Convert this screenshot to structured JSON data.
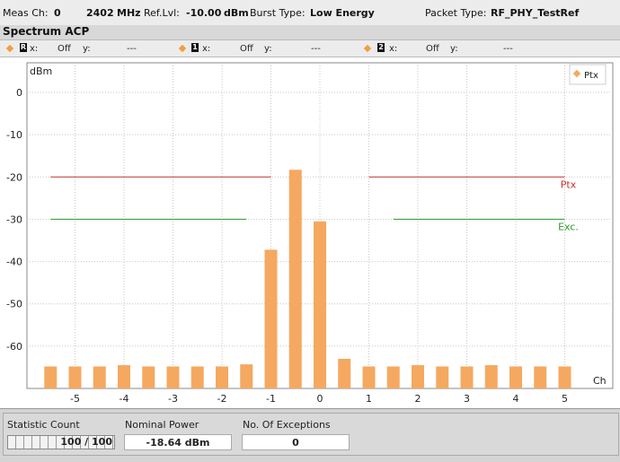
{
  "header": {
    "meas_ch_label": "Meas Ch:",
    "meas_ch_value": "0",
    "freq_value": "2402",
    "freq_unit": "MHz",
    "ref_lvl_label": "Ref.Lvl:",
    "ref_lvl_value": "-10.00",
    "ref_lvl_unit": "dBm",
    "burst_type_label": "Burst Type:",
    "burst_type_value": "Low Energy",
    "packet_type_label": "Packet Type:",
    "packet_type_value": "RF_PHY_TestRef"
  },
  "title": "Spectrum ACP",
  "markers": [
    {
      "id": "R",
      "x_label": "x:",
      "x_value": "Off",
      "y_label": "y:",
      "y_value": "---"
    },
    {
      "id": "1",
      "x_label": "x:",
      "x_value": "Off",
      "y_label": "y:",
      "y_value": "---"
    },
    {
      "id": "2",
      "x_label": "x:",
      "x_value": "Off",
      "y_label": "y:",
      "y_value": "---"
    }
  ],
  "chart_data": {
    "type": "bar",
    "ylabel": "dBm",
    "xlabel": "Ch",
    "ylim": [
      -70,
      0
    ],
    "y_ticks": [
      0,
      -10,
      -20,
      -30,
      -40,
      -50,
      -60
    ],
    "x_ticks": [
      -5,
      -4,
      -3,
      -2,
      -1,
      0,
      1,
      2,
      3,
      4,
      5
    ],
    "legend": {
      "name": "Ptx",
      "placement": "top-right"
    },
    "series": [
      {
        "name": "Ptx",
        "color": "#f5a860",
        "x": [
          -5.5,
          -5,
          -4.5,
          -4,
          -3.5,
          -3,
          -2.5,
          -2,
          -1.5,
          -1,
          -0.5,
          0,
          0.5,
          1,
          1.5,
          2,
          2.5,
          3,
          3.5,
          4,
          4.5,
          5
        ],
        "values": [
          -64.8,
          -64.8,
          -64.8,
          -64.5,
          -64.8,
          -64.8,
          -64.8,
          -64.8,
          -64.3,
          -37.2,
          -18.3,
          -30.5,
          -63.0,
          -64.8,
          -64.8,
          -64.5,
          -64.8,
          -64.8,
          -64.5,
          -64.8,
          -64.8,
          -64.8
        ]
      }
    ],
    "limit_lines": [
      {
        "name": "Ptx",
        "value": -20,
        "color": "#c83030",
        "segments": [
          [
            -5.5,
            -1
          ],
          [
            1,
            5
          ]
        ]
      },
      {
        "name": "Exc.",
        "value": -30,
        "color": "#2a9a2a",
        "segments": [
          [
            -5.5,
            -1.5
          ],
          [
            1.5,
            5
          ]
        ]
      }
    ]
  },
  "bottom": {
    "stat_count_label": "Statistic Count",
    "stat_count_value": "100 / 100",
    "stat_fraction": 1.0,
    "nominal_power_label": "Nominal Power",
    "nominal_power_value": "-18.64  dBm",
    "exceptions_label": "No. Of Exceptions",
    "exceptions_value": "0"
  }
}
